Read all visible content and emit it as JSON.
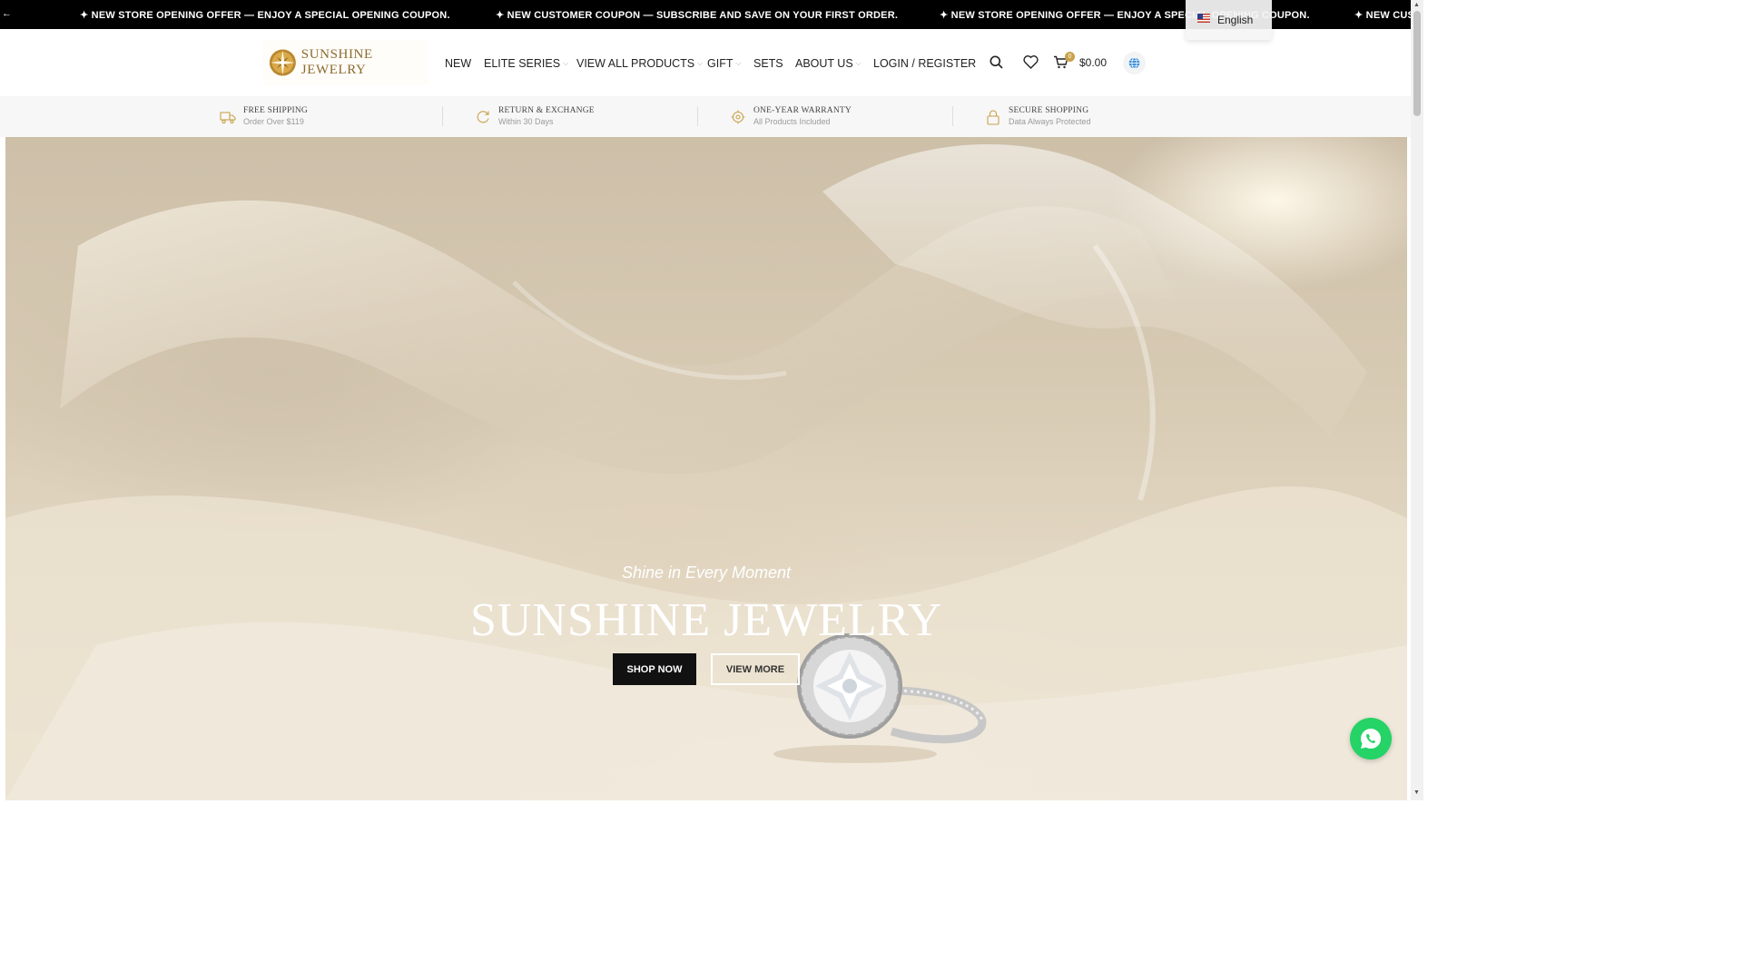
{
  "announcement": {
    "lead_glyph": "←",
    "messages": [
      "✦ NEW STORE OPENING OFFER — ENJOY A SPECIAL OPENING COUPON.",
      "✦ NEW CUSTOMER COUPON — SUBSCRIBE AND SAVE ON YOUR FIRST ORDER.",
      "✦ NEW STORE OPENING OFFER — ENJOY A SPECIAL OPENING COUPON.",
      "✦ NEW CUS"
    ]
  },
  "language": {
    "selected": "English",
    "flag_icon": "us-flag-icon"
  },
  "header": {
    "logo_text": "SUNSHINE JEWELRY",
    "nav": [
      {
        "label": "NEW",
        "has_dropdown": false
      },
      {
        "label": "ELITE SERIES",
        "has_dropdown": true
      },
      {
        "label": "VIEW ALL PRODUCTS",
        "has_dropdown": true
      },
      {
        "label": "GIFT",
        "has_dropdown": true
      },
      {
        "label": "SETS",
        "has_dropdown": false
      },
      {
        "label": "ABOUT US",
        "has_dropdown": true
      }
    ],
    "login_label": "LOGIN / REGISTER",
    "cart_count": "0",
    "cart_total": "$0.00",
    "icons": [
      "search-icon",
      "heart-icon",
      "cart-icon",
      "globe-icon"
    ],
    "accent_color": "#c9a24b"
  },
  "features": [
    {
      "title": "FREE SHIPPING",
      "subtitle": "Order Over $119",
      "icon": "truck-icon"
    },
    {
      "title": "RETURN & EXCHANGE",
      "subtitle": "Within 30 Days",
      "icon": "return-icon"
    },
    {
      "title": "ONE-YEAR WARRANTY",
      "subtitle": "All Products Included",
      "icon": "warranty-icon"
    },
    {
      "title": "SECURE SHOPPING",
      "subtitle": "Data Always Protected",
      "icon": "lock-icon"
    }
  ],
  "hero": {
    "subtitle": "Shine in Every Moment",
    "title": "SUNSHINE JEWELRY",
    "primary_button": "SHOP NOW",
    "secondary_button": "VIEW MORE"
  },
  "chat": {
    "icon": "whatsapp-icon",
    "color": "#25d366"
  }
}
